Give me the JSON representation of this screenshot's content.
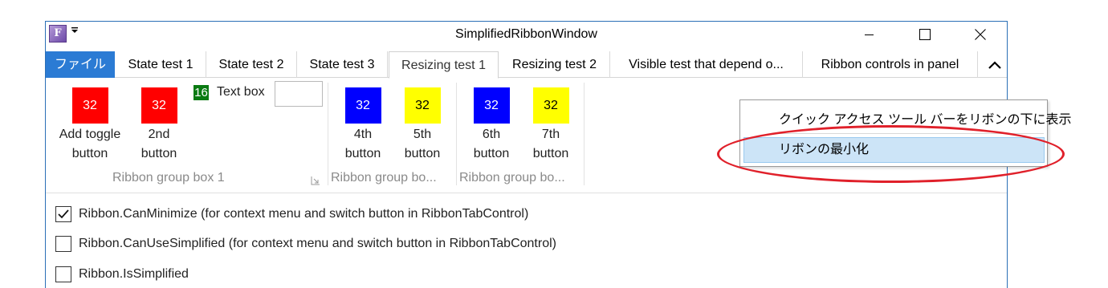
{
  "window": {
    "title": "SimplifiedRibbonWindow",
    "app_icon_text": "F"
  },
  "tabs": [
    {
      "label": "ファイル"
    },
    {
      "label": "State test 1"
    },
    {
      "label": "State test 2"
    },
    {
      "label": "State test 3"
    },
    {
      "label": "Resizing test 1"
    },
    {
      "label": "Resizing test 2"
    },
    {
      "label": "Visible test that depend o..."
    },
    {
      "label": "Ribbon controls in panel"
    }
  ],
  "active_tab": "Resizing test 1",
  "ribbon": {
    "buttons": [
      {
        "icon_text": "32",
        "label1": "Add toggle",
        "label2": "button",
        "color": "#ff0000"
      },
      {
        "icon_text": "32",
        "label1": "2nd",
        "label2": "button",
        "color": "#ff0000"
      },
      {
        "icon_text": "32",
        "label1": "4th",
        "label2": "button",
        "color": "#0000ff"
      },
      {
        "icon_text": "32",
        "label1": "5th",
        "label2": "button",
        "color": "#ffff00"
      },
      {
        "icon_text": "32",
        "label1": "6th",
        "label2": "button",
        "color": "#0000ff"
      },
      {
        "icon_text": "32",
        "label1": "7th",
        "label2": "button",
        "color": "#ffff00"
      }
    ],
    "textbox": {
      "icon_text": "16",
      "label": "Text box",
      "value": ""
    },
    "groups": [
      {
        "label": "Ribbon group box 1"
      },
      {
        "label": "Ribbon group bo..."
      },
      {
        "label": "Ribbon group bo..."
      }
    ]
  },
  "context_menu": {
    "items": [
      {
        "label": "クイック アクセス ツール バーをリボンの下に表示"
      },
      {
        "label": "リボンの最小化",
        "highlighted": true
      }
    ]
  },
  "checkboxes": [
    {
      "label": "Ribbon.CanMinimize (for context menu and switch button in RibbonTabControl)",
      "checked": true
    },
    {
      "label": "Ribbon.CanUseSimplified (for context menu and switch button in RibbonTabControl)",
      "checked": false
    },
    {
      "label": "Ribbon.IsSimplified",
      "checked": false
    }
  ],
  "colors": {
    "file_tab": "#2b7bd4",
    "menu_highlight": "#cce4f7",
    "annotation_ring": "#e0202a"
  }
}
